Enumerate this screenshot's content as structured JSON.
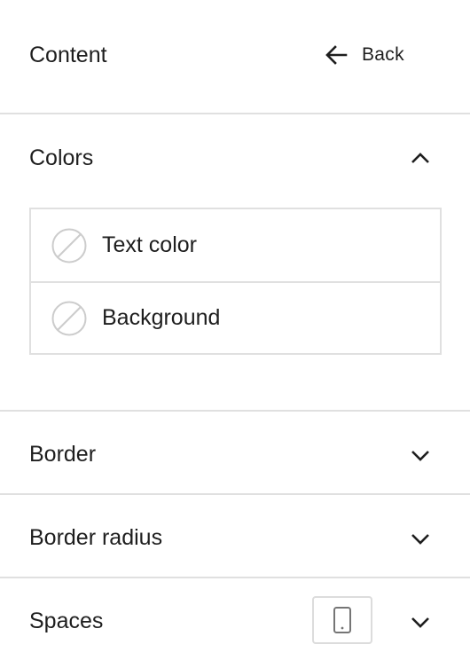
{
  "header": {
    "title": "Content",
    "back_label": "Back",
    "back_icon": "arrow-left-icon"
  },
  "panels": {
    "colors": {
      "title": "Colors",
      "expanded": true,
      "toggle_icon": "chevron-up-icon",
      "items": [
        {
          "label": "Text color",
          "icon": "no-color-swatch-icon"
        },
        {
          "label": "Background",
          "icon": "no-color-swatch-icon"
        }
      ]
    },
    "border": {
      "title": "Border",
      "expanded": false,
      "toggle_icon": "chevron-down-icon"
    },
    "border_radius": {
      "title": "Border radius",
      "expanded": false,
      "toggle_icon": "chevron-down-icon"
    },
    "spaces": {
      "title": "Spaces",
      "expanded": false,
      "device_icon": "mobile-device-icon",
      "toggle_icon": "chevron-down-icon"
    }
  },
  "colors": {
    "text": "#1e1e1e",
    "divider": "#e0e0e0",
    "swatch_outline": "#cccccc"
  }
}
